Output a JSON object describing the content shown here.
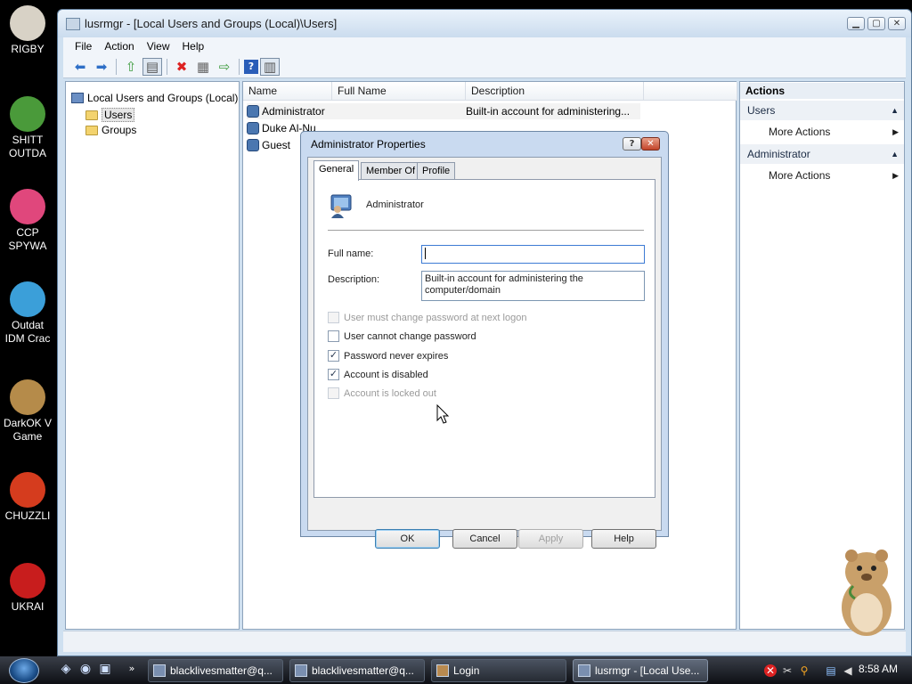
{
  "desktop": {
    "icons": [
      {
        "label": "RIGBY",
        "color": "#d8d2c6"
      },
      {
        "label": "SHITT\nOUTDA",
        "color": "#4a9a3a"
      },
      {
        "label": "CCP\nSPYWA",
        "color": "#e0477c"
      },
      {
        "label": "Outdat\nIDM Crac",
        "color": "#3b9fd9"
      },
      {
        "label": "DarkOK V\nGame",
        "color": "#b58b4a"
      },
      {
        "label": "CHUZZLI",
        "color": "#d53c1e"
      },
      {
        "label": "UKRAI",
        "color": "#c81d1d"
      }
    ]
  },
  "window": {
    "title": "lusrmgr - [Local Users and Groups (Local)\\Users]",
    "caption_buttons": [
      "minimize-icon",
      "maximize-icon",
      "close-icon"
    ],
    "menu": [
      "File",
      "Action",
      "View",
      "Help"
    ],
    "toolbar_icons": [
      "back-arrow-icon",
      "forward-arrow-icon",
      "up-folder-icon",
      "show-tree-icon",
      "delete-icon",
      "properties-icon",
      "export-icon",
      "help-icon",
      "action-pane-icon"
    ]
  },
  "tree": {
    "root": "Local Users and Groups (Local)",
    "children": [
      "Users",
      "Groups"
    ],
    "selected": "Users"
  },
  "list": {
    "columns": [
      "Name",
      "Full Name",
      "Description"
    ],
    "rows": [
      {
        "name": "Administrator",
        "full_name": "",
        "description": "Built-in account for administering..."
      },
      {
        "name": "Duke Al-Nu",
        "full_name": "",
        "description": ""
      },
      {
        "name": "Guest",
        "full_name": "",
        "description": ""
      }
    ]
  },
  "actions": {
    "header": "Actions",
    "sections": [
      {
        "title": "Users",
        "items": [
          "More Actions"
        ]
      },
      {
        "title": "Administrator",
        "items": [
          "More Actions"
        ]
      }
    ]
  },
  "dialog": {
    "title": "Administrator Properties",
    "tabs": [
      "General",
      "Member Of",
      "Profile"
    ],
    "active_tab": "General",
    "account_name": "Administrator",
    "full_name_label": "Full name:",
    "full_name_value": "",
    "description_label": "Description:",
    "description_value": "Built-in account for administering the computer/domain",
    "checkboxes": [
      {
        "label": "User must change password at next logon",
        "checked": false,
        "enabled": false
      },
      {
        "label": "User cannot change password",
        "checked": false,
        "enabled": true
      },
      {
        "label": "Password never expires",
        "checked": true,
        "enabled": true
      },
      {
        "label": "Account is disabled",
        "checked": true,
        "enabled": true
      },
      {
        "label": "Account is locked out",
        "checked": false,
        "enabled": false
      }
    ],
    "buttons": {
      "ok": "OK",
      "cancel": "Cancel",
      "apply": "Apply",
      "help": "Help"
    }
  },
  "taskbar": {
    "tasks": [
      {
        "label": "blacklivesmatter@q..."
      },
      {
        "label": "blacklivesmatter@q..."
      },
      {
        "label": "Login"
      },
      {
        "label": "lusrmgr - [Local Use..."
      }
    ],
    "clock": "8:58 AM"
  }
}
